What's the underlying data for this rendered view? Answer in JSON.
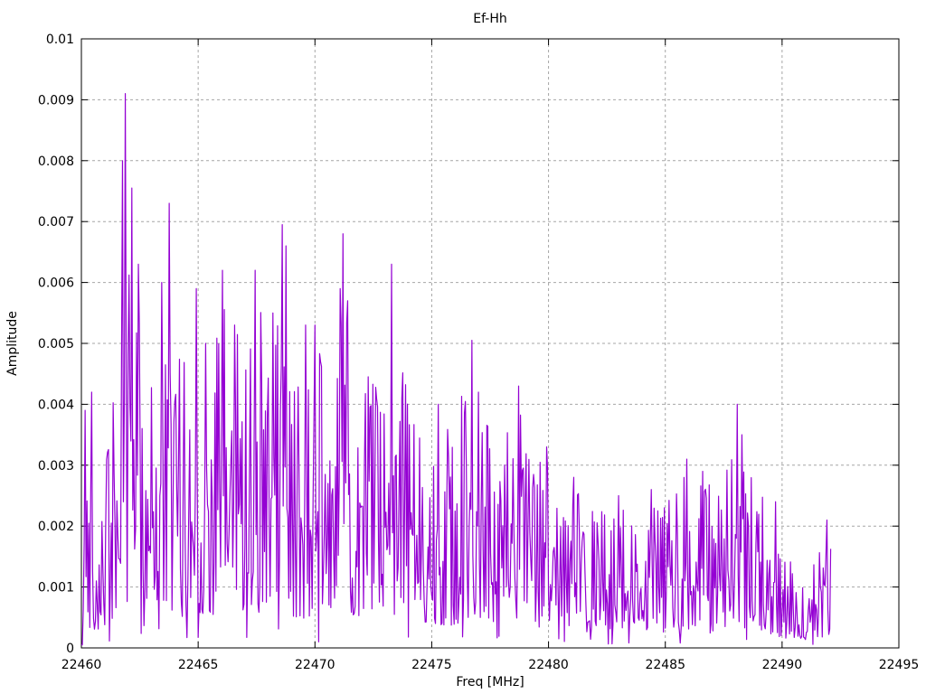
{
  "page": {
    "background": "#ffffff",
    "text_color": "#000000"
  },
  "chart_data": {
    "type": "line",
    "title": "Ef-Hh",
    "xlabel": "Freq [MHz]",
    "ylabel": "Amplitude",
    "xlim": [
      22460,
      22495
    ],
    "ylim": [
      0,
      0.01
    ],
    "x_ticks": [
      22460,
      22465,
      22470,
      22475,
      22480,
      22485,
      22490,
      22495
    ],
    "x_tick_labels": [
      "22460",
      "22465",
      "22470",
      "22475",
      "22480",
      "22485",
      "22490",
      "22495"
    ],
    "y_ticks": [
      0,
      0.001,
      0.002,
      0.003,
      0.004,
      0.005,
      0.006,
      0.007,
      0.008,
      0.009,
      0.01
    ],
    "y_tick_labels": [
      "0",
      "0.001",
      "0.002",
      "0.003",
      "0.004",
      "0.005",
      "0.006",
      "0.007",
      "0.008",
      "0.009",
      "0.01"
    ],
    "grid": {
      "show": true,
      "color": "#a6a6a6",
      "dash": "3 3",
      "width": 1
    },
    "frame_color": "#000000",
    "tick_length": 7,
    "legend": "none",
    "series": [
      {
        "name": "Ef-Hh",
        "color": "#9400d3",
        "line_width": 1.2,
        "x_start": 22460.0,
        "x_end": 22492.08,
        "sample_step_mhz": 0.04,
        "noise_seed": 42,
        "noise_floor_fraction": 0.1,
        "noise_shape_exponent": 1.6,
        "deep_dip_probability": 0.05,
        "deep_dip_factor": 0.25,
        "envelope_anchors": [
          [
            22460.0,
            0.0042
          ],
          [
            22460.6,
            0.0028
          ],
          [
            22461.2,
            0.0036
          ],
          [
            22461.7,
            0.0062
          ],
          [
            22462.3,
            0.0065
          ],
          [
            22463.0,
            0.005
          ],
          [
            22463.8,
            0.0056
          ],
          [
            22464.5,
            0.0049
          ],
          [
            22465.2,
            0.0052
          ],
          [
            22465.9,
            0.0055
          ],
          [
            22466.5,
            0.006
          ],
          [
            22467.3,
            0.0058
          ],
          [
            22468.0,
            0.0054
          ],
          [
            22468.7,
            0.0058
          ],
          [
            22469.4,
            0.0048
          ],
          [
            22470.0,
            0.005
          ],
          [
            22470.7,
            0.0048
          ],
          [
            22471.3,
            0.0056
          ],
          [
            22472.0,
            0.0048
          ],
          [
            22472.8,
            0.0042
          ],
          [
            22473.4,
            0.0052
          ],
          [
            22474.2,
            0.0044
          ],
          [
            22475.0,
            0.0038
          ],
          [
            22475.8,
            0.0037
          ],
          [
            22476.7,
            0.0046
          ],
          [
            22477.5,
            0.004
          ],
          [
            22478.2,
            0.0036
          ],
          [
            22478.8,
            0.004
          ],
          [
            22479.5,
            0.0033
          ],
          [
            22480.2,
            0.0028
          ],
          [
            22481.0,
            0.0027
          ],
          [
            22482.0,
            0.0024
          ],
          [
            22483.0,
            0.0023
          ],
          [
            22484.0,
            0.0025
          ],
          [
            22485.0,
            0.0026
          ],
          [
            22485.9,
            0.003
          ],
          [
            22486.6,
            0.0029
          ],
          [
            22487.3,
            0.0026
          ],
          [
            22488.1,
            0.0034
          ],
          [
            22488.8,
            0.0027
          ],
          [
            22489.5,
            0.0023
          ],
          [
            22490.2,
            0.0015
          ],
          [
            22491.0,
            0.0013
          ],
          [
            22491.6,
            0.0017
          ],
          [
            22492.1,
            0.0019
          ]
        ],
        "peaks": [
          [
            22460.15,
            0.0039
          ],
          [
            22460.45,
            0.0042
          ],
          [
            22461.75,
            0.008
          ],
          [
            22461.88,
            0.0091
          ],
          [
            22462.17,
            0.00755
          ],
          [
            22462.45,
            0.0063
          ],
          [
            22463.45,
            0.006
          ],
          [
            22463.75,
            0.0073
          ],
          [
            22464.9,
            0.0059
          ],
          [
            22466.05,
            0.0062
          ],
          [
            22466.55,
            0.0053
          ],
          [
            22467.45,
            0.0062
          ],
          [
            22468.2,
            0.0055
          ],
          [
            22468.6,
            0.00695
          ],
          [
            22468.75,
            0.0066
          ],
          [
            22469.6,
            0.0053
          ],
          [
            22470.0,
            0.0053
          ],
          [
            22471.1,
            0.0059
          ],
          [
            22471.2,
            0.0068
          ],
          [
            22471.4,
            0.0057
          ],
          [
            22473.3,
            0.0063
          ],
          [
            22475.3,
            0.004
          ],
          [
            22476.7,
            0.00505
          ],
          [
            22477.0,
            0.0042
          ],
          [
            22478.7,
            0.0043
          ],
          [
            22479.9,
            0.0033
          ],
          [
            22481.1,
            0.0028
          ],
          [
            22483.0,
            0.0025
          ],
          [
            22484.4,
            0.0026
          ],
          [
            22485.9,
            0.0031
          ],
          [
            22486.6,
            0.0029
          ],
          [
            22488.1,
            0.004
          ],
          [
            22488.3,
            0.0035
          ],
          [
            22489.7,
            0.0024
          ],
          [
            22491.9,
            0.0021
          ]
        ],
        "dips": [
          [
            22460.02,
            5e-05
          ],
          [
            22470.15,
            0.0001
          ]
        ]
      }
    ]
  }
}
